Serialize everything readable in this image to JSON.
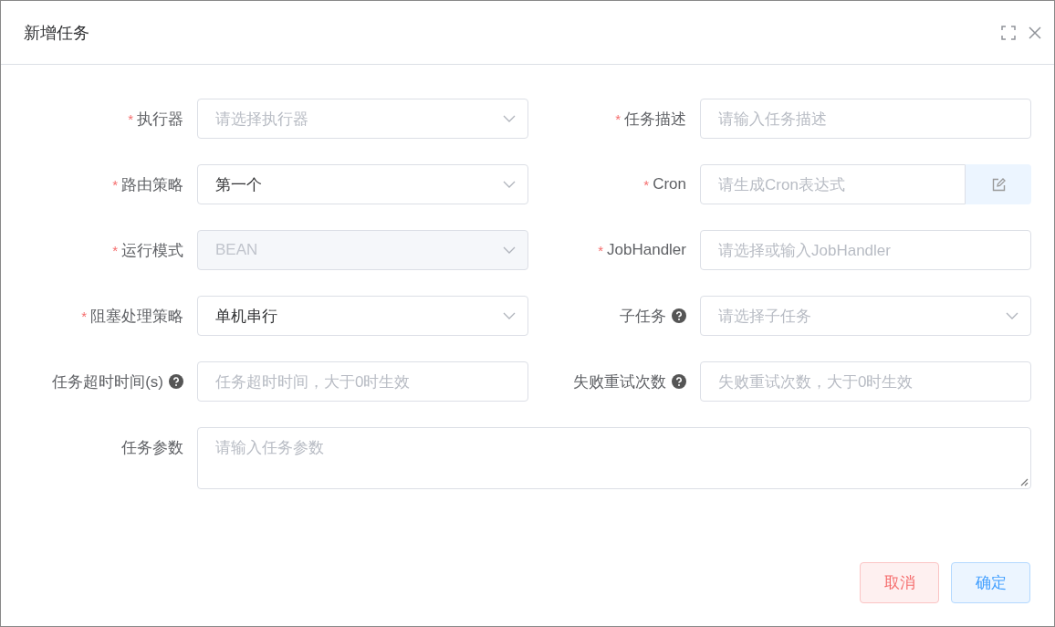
{
  "dialog": {
    "title": "新增任务"
  },
  "required_mark": "*",
  "fields": [
    {
      "kind": "select",
      "label": "执行器",
      "required": true,
      "help": false,
      "placeholder": "请选择执行器",
      "disabled": false
    },
    {
      "kind": "input",
      "label": "任务描述",
      "required": true,
      "help": false,
      "placeholder": "请输入任务描述",
      "disabled": false
    },
    {
      "kind": "select",
      "label": "路由策略",
      "required": true,
      "help": false,
      "value": "第一个",
      "disabled": false
    },
    {
      "kind": "cron",
      "label": "Cron",
      "required": true,
      "help": false,
      "placeholder": "请生成Cron表达式"
    },
    {
      "kind": "select",
      "label": "运行模式",
      "required": true,
      "help": false,
      "value": "BEAN",
      "disabled": true
    },
    {
      "kind": "input",
      "label": "JobHandler",
      "required": true,
      "help": false,
      "placeholder": "请选择或输入JobHandler",
      "disabled": false
    },
    {
      "kind": "select",
      "label": "阻塞处理策略",
      "required": true,
      "help": false,
      "value": "单机串行",
      "disabled": false
    },
    {
      "kind": "select",
      "label": "子任务",
      "required": false,
      "help": true,
      "placeholder": "请选择子任务",
      "disabled": false
    },
    {
      "kind": "input",
      "label": "任务超时时间(s)",
      "required": false,
      "help": true,
      "placeholder": "任务超时时间，大于0时生效",
      "disabled": false
    },
    {
      "kind": "input",
      "label": "失败重试次数",
      "required": false,
      "help": true,
      "placeholder": "失败重试次数，大于0时生效",
      "disabled": false
    },
    {
      "kind": "textarea",
      "label": "任务参数",
      "required": false,
      "help": false,
      "placeholder": "请输入任务参数"
    }
  ],
  "buttons": [
    {
      "label": "取消",
      "kind": "danger"
    },
    {
      "label": "确定",
      "kind": "primary"
    }
  ]
}
